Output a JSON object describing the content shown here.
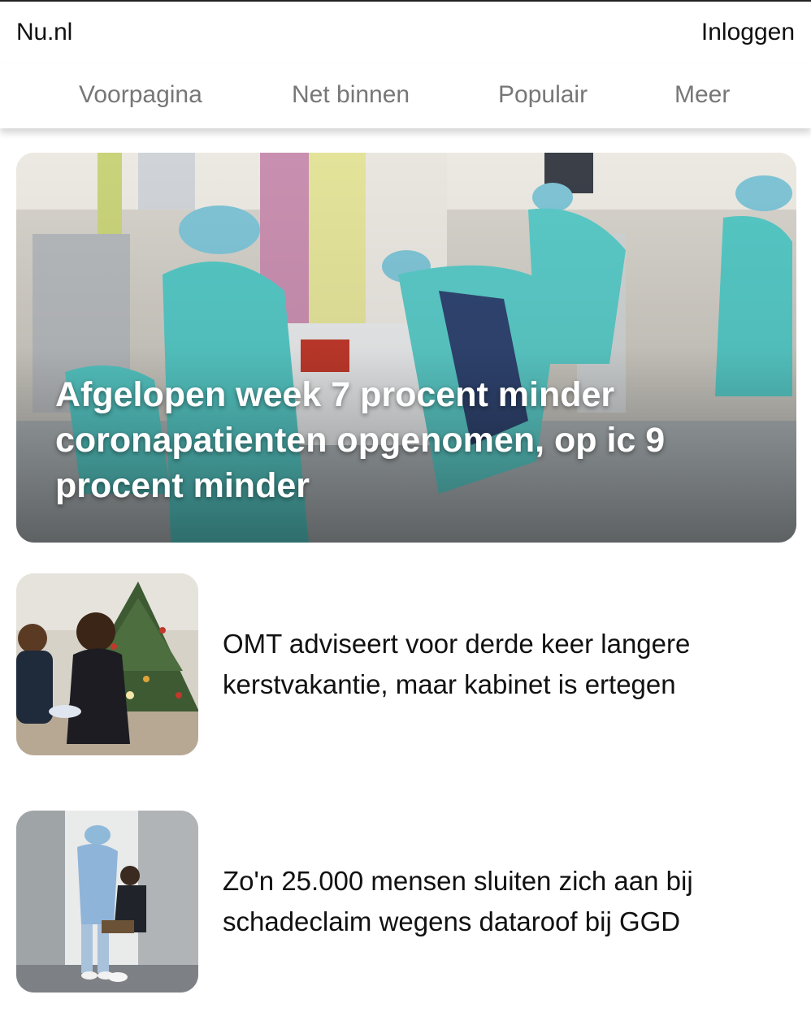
{
  "header": {
    "brand": "Nu.nl",
    "login_label": "Inloggen"
  },
  "nav": {
    "items": [
      {
        "label": "Voorpagina"
      },
      {
        "label": "Net binnen"
      },
      {
        "label": "Populair"
      },
      {
        "label": "Meer"
      }
    ]
  },
  "hero": {
    "title": "Afgelopen week 7 procent minder coronapatienten opgenomen, op ic 9 procent minder",
    "image_icon": "hospital-ic-photo"
  },
  "articles": [
    {
      "title": "OMT adviseert voor derde keer langere kerstvakantie, maar kabinet is ertegen",
      "image_icon": "christmas-tree-photo"
    },
    {
      "title": "Zo'n 25.000 mensen sluiten zich aan bij schadeclaim wegens dataroof bij GGD",
      "image_icon": "covid-test-photo"
    }
  ],
  "colors": {
    "nav_text": "#777777",
    "text": "#111111",
    "hero_text": "#ffffff"
  }
}
